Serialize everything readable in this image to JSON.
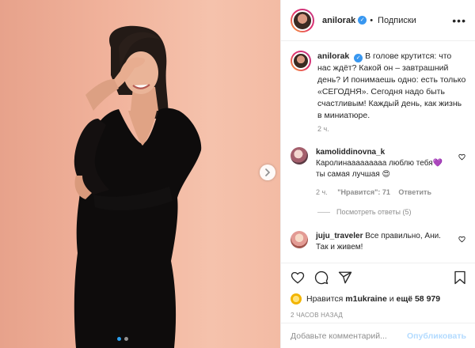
{
  "header": {
    "username": "anilorak",
    "verified_icon": "verified-badge-icon",
    "separator": "•",
    "follow_label": "Подписки",
    "more_icon": "more-options-icon"
  },
  "caption": {
    "username": "anilorak",
    "text": "В голове крутится: что нас ждёт? Какой он – завтрашний день? И понимаешь одно: есть только «СЕГОДНЯ». Сегодня надо быть счастливым! Каждый день, как жизнь в миниатюре.",
    "time": "2 ч."
  },
  "comments": [
    {
      "username": "kamoliddinovna_k",
      "text": "Каролинааааааааа люблю тебя💜 ты самая лучшая 😍",
      "time": "2 ч.",
      "likes": "\"Нравится\": 71",
      "reply_label": "Ответить",
      "view_replies": "Посмотреть ответы (5)"
    },
    {
      "username": "juju_traveler",
      "text": "Все правильно, Ани. Так и живем!"
    }
  ],
  "actions": {
    "like_icon": "heart-icon",
    "comment_icon": "comment-icon",
    "share_icon": "share-icon",
    "save_icon": "bookmark-icon"
  },
  "likes": {
    "prefix": "Нравится",
    "user": "m1ukraine",
    "connector": "и",
    "others": "ещё 58 979"
  },
  "posted_ago": "2 ЧАСОВ НАЗАД",
  "add_comment": {
    "placeholder": "Добавьте комментарий...",
    "publish_label": "Опубликовать"
  },
  "carousel": {
    "slide_count": 2,
    "active_index": 0,
    "next_icon": "chevron-right-icon"
  },
  "colors": {
    "accent": "#3897f0",
    "publish_disabled": "#b3dbff",
    "muted_text": "#8e8e8e",
    "active_dot": "#2b9fee"
  }
}
